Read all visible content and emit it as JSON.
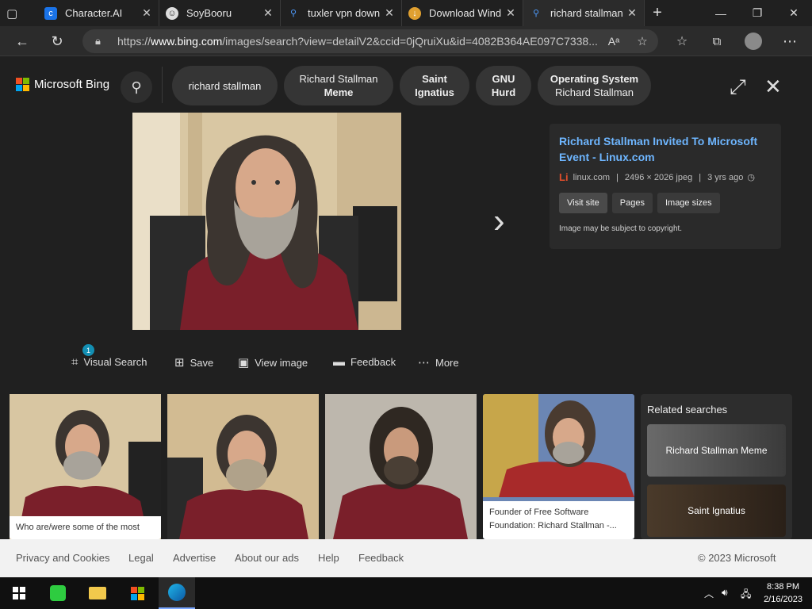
{
  "tabs": [
    {
      "title": "",
      "icon": "tab-actions-icon"
    },
    {
      "title": "Character.AI",
      "icon": "characterai-icon"
    },
    {
      "title": "SoyBooru",
      "icon": "soybooru-icon"
    },
    {
      "title": "tuxler vpn down",
      "icon": "bing-search-icon"
    },
    {
      "title": "Download Wind",
      "icon": "download-site-icon"
    },
    {
      "title": "richard stallman",
      "icon": "bing-search-icon"
    }
  ],
  "browser": {
    "url_prefix": "https://",
    "url_host": "www.bing.com",
    "url_rest": "/images/search?view=detailV2&ccid=0jQruiXu&id=4082B364AE097C7338..."
  },
  "bing": {
    "logo_text": "Microsoft Bing",
    "chips": [
      {
        "line1": "richard stallman",
        "line2": ""
      },
      {
        "line1": "Richard Stallman",
        "line2": "Meme"
      },
      {
        "line1": "Saint",
        "line2": "Ignatius"
      },
      {
        "line1": "GNU",
        "line2": "Hurd"
      },
      {
        "line1": "Operating System",
        "line2": "Richard Stallman"
      }
    ]
  },
  "info": {
    "title": "Richard Stallman Invited To Microsoft Event - Linux.com",
    "site_icon": "Li",
    "site": "linux.com",
    "sep1": "|",
    "dims": "2496 × 2026 jpeg",
    "sep2": "|",
    "age": "3 yrs ago",
    "buttons": [
      "Visit site",
      "Pages",
      "Image sizes"
    ],
    "copyright": "Image may be subject to copyright."
  },
  "actions": {
    "visual_search": "Visual Search",
    "visual_badge": "1",
    "save": "Save",
    "view_image": "View image",
    "feedback": "Feedback",
    "more": "More"
  },
  "thumbs": {
    "cap1": "Who are/were some of the most",
    "cap4": "Founder of Free Software Foundation: Richard Stallman -..."
  },
  "related": {
    "heading": "Related searches",
    "items": [
      "Richard Stallman Meme",
      "Saint Ignatius"
    ]
  },
  "footer": {
    "links": [
      "Privacy and Cookies",
      "Legal",
      "Advertise",
      "About our ads",
      "Help",
      "Feedback"
    ],
    "copyright": "© 2023 Microsoft"
  },
  "taskbar": {
    "time": "8:38 PM",
    "date": "2/16/2023"
  },
  "colors": {
    "link_blue": "#6eb6ff",
    "bing_bg": "#202020",
    "ms_red": "#f25022",
    "ms_green": "#7fba00",
    "ms_blue": "#00a4ef",
    "ms_yellow": "#ffb900"
  }
}
